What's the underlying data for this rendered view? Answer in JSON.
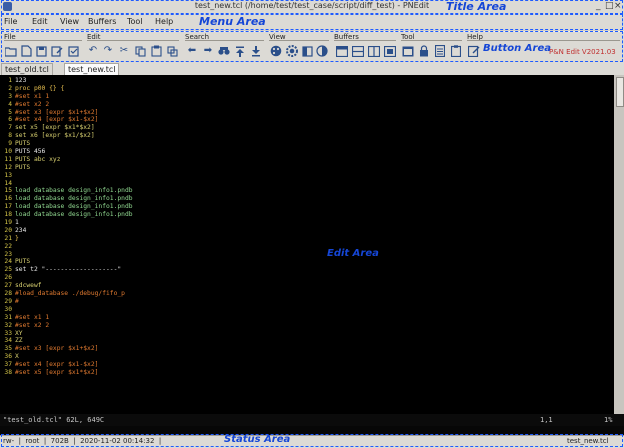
{
  "window": {
    "title": "test_new.tcl (/home/test/test_case/script/diff_test) - PNEdit",
    "controls": [
      "_",
      "□",
      "×"
    ]
  },
  "menu": [
    "File",
    "Edit",
    "View",
    "Buffers",
    "Tool",
    "Help"
  ],
  "toolbar": {
    "groups": [
      "File",
      "Edit",
      "Search",
      "View",
      "Buffers",
      "Tool",
      "Help"
    ],
    "version": "P&N Edit V2021.03"
  },
  "tabs": [
    {
      "label": "test_old.tcl",
      "active": false
    },
    {
      "label": "test_new.tcl",
      "active": true
    }
  ],
  "editor": {
    "lines": [
      {
        "n": "1",
        "text": "123",
        "color": "#e8e8e8"
      },
      {
        "n": "2",
        "text": "proc p00 {} {",
        "color": "#e8c050"
      },
      {
        "n": "3",
        "text": "#set x1 1",
        "color": "#e07a30"
      },
      {
        "n": "4",
        "text": "#set x2 2",
        "color": "#e07a30"
      },
      {
        "n": "5",
        "text": "#set x3 [expr $x1+$x2]",
        "color": "#e07a30"
      },
      {
        "n": "6",
        "text": "#set x4 [expr $x1-$x2]",
        "color": "#e07a30"
      },
      {
        "n": "7",
        "text": "set x5 [expr $x1*$x2]",
        "color": "#d8d070"
      },
      {
        "n": "8",
        "text": "set x6 [expr $x1/$x2]",
        "color": "#d8d070"
      },
      {
        "n": "9",
        "text": "PUTS",
        "color": "#d8d070"
      },
      {
        "n": "10",
        "text": "PUTS 456",
        "color": "#e8e8e8"
      },
      {
        "n": "11",
        "text": "PUTS abc xyz",
        "color": "#d8d070"
      },
      {
        "n": "12",
        "text": "PUTS",
        "color": "#d8d070"
      },
      {
        "n": "13",
        "text": "",
        "color": "#e8e8e8"
      },
      {
        "n": "14",
        "text": "",
        "color": "#e8e8e8"
      },
      {
        "n": "15",
        "text": "load database design_info1.pndb",
        "color": "#90d890"
      },
      {
        "n": "16",
        "text": "load database design_info1.pndb",
        "color": "#90d890"
      },
      {
        "n": "17",
        "text": "load database design_info1.pndb",
        "color": "#90d890"
      },
      {
        "n": "18",
        "text": "load database design_info1.pndb",
        "color": "#90d890"
      },
      {
        "n": "19",
        "text": "1",
        "color": "#e8e8e8"
      },
      {
        "n": "20",
        "text": "234",
        "color": "#e8e8e8"
      },
      {
        "n": "21",
        "text": "}",
        "color": "#e8c050"
      },
      {
        "n": "22",
        "text": "",
        "color": "#e8e8e8"
      },
      {
        "n": "23",
        "text": "",
        "color": "#e8e8e8"
      },
      {
        "n": "24",
        "text": "PUTS",
        "color": "#d8d070"
      },
      {
        "n": "25",
        "text": "set t2 \"-------------------\"",
        "color": "#e8e8e8"
      },
      {
        "n": "26",
        "text": "",
        "color": "#e8e8e8"
      },
      {
        "n": "27",
        "text": "sdcwewf",
        "color": "#d8d070"
      },
      {
        "n": "28",
        "text": "#load_database ./debug/fifo_p",
        "color": "#e07a30"
      },
      {
        "n": "29",
        "text": "#",
        "color": "#e07a30"
      },
      {
        "n": "30",
        "text": "",
        "color": "#e8e8e8"
      },
      {
        "n": "31",
        "text": "#set x1 1",
        "color": "#e07a30"
      },
      {
        "n": "32",
        "text": "#set x2 2",
        "color": "#e07a30"
      },
      {
        "n": "33",
        "text": "XY",
        "color": "#d8d070"
      },
      {
        "n": "34",
        "text": "ZZ",
        "color": "#d8d070"
      },
      {
        "n": "35",
        "text": "#set x3 [expr $x1+$x2]",
        "color": "#e07a30"
      },
      {
        "n": "36",
        "text": "X",
        "color": "#d8d070"
      },
      {
        "n": "37",
        "text": "#set x4 [expr $x1-$x2]",
        "color": "#e07a30"
      },
      {
        "n": "38",
        "text": "#set x5 [expr $x1*$x2]",
        "color": "#e07a30"
      }
    ]
  },
  "editor_status": {
    "file": "\"test_old.tcl\" 62L, 649C",
    "cursor": "1,1",
    "percent": "1%"
  },
  "statusbar": {
    "left": "rw-  |  root  |  702B  |  2020-11-02 00:14:32  |",
    "right": "test_new.tcl"
  },
  "annotations": {
    "title_area": "Title Area",
    "menu_area": "Menu Area",
    "button_area": "Button Area",
    "edit_area": "Edit Area",
    "status_area": "Status Area"
  },
  "colors": {
    "annotation": "#1546d6",
    "editor_bg": "#000000",
    "line_number": "#d7c84a",
    "version": "#c03030"
  }
}
